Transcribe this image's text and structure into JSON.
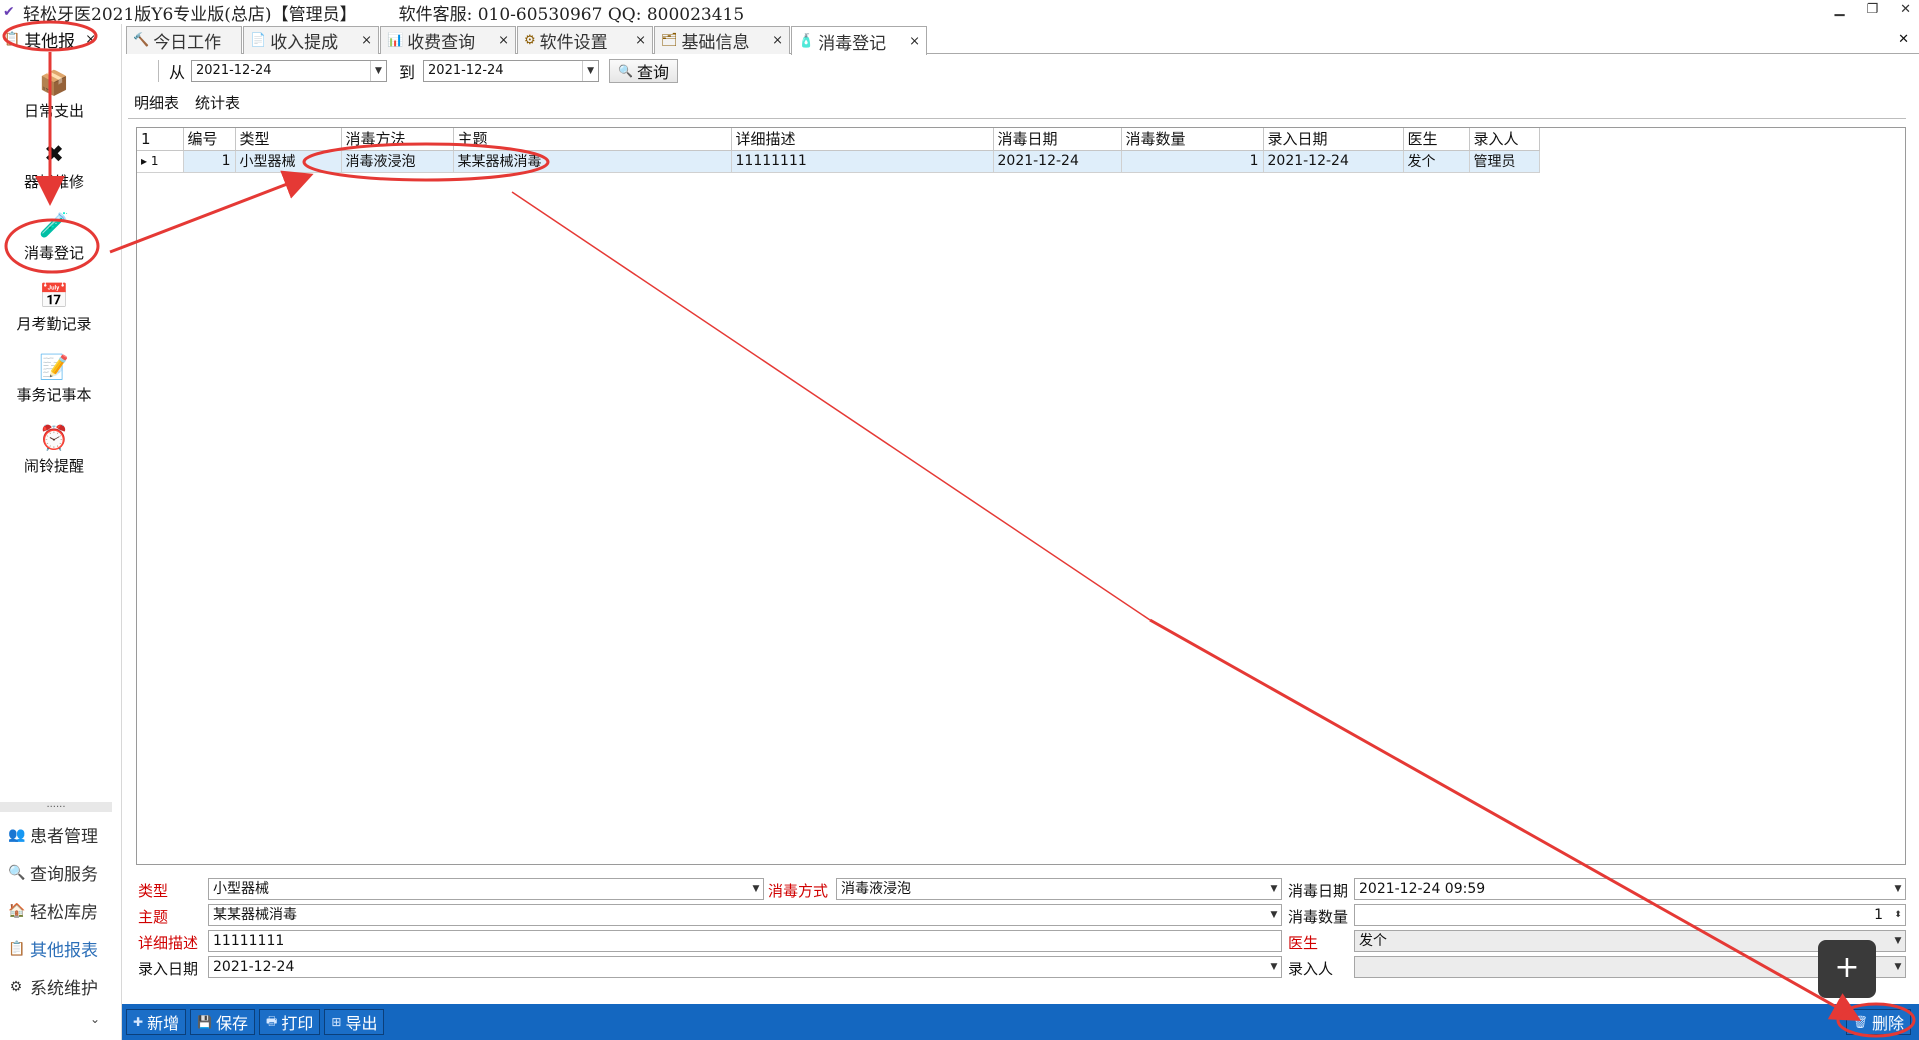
{
  "window": {
    "title": "轻松牙医2021版Y6专业版(总店)【管理员】",
    "service": "软件客服: 010-60530967  QQ: 800023415",
    "min_label": "▁",
    "restore_label": "❐",
    "close_label": "✕"
  },
  "sidebar": {
    "tab_label": "其他报",
    "tab_close": "×",
    "items": [
      {
        "label": "日常支出",
        "icon": "box-icon",
        "glyph": "📦"
      },
      {
        "label": "器械维修",
        "icon": "wrench-icon",
        "glyph": "✖"
      },
      {
        "label": "消毒登记",
        "icon": "disinfect-icon",
        "glyph": "🧪"
      },
      {
        "label": "月考勤记录",
        "icon": "calendar-icon",
        "glyph": "📅"
      },
      {
        "label": "事务记事本",
        "icon": "notepad-icon",
        "glyph": "📝"
      },
      {
        "label": "闹铃提醒",
        "icon": "alarm-clock-icon",
        "glyph": "⏰"
      }
    ],
    "sep_label": "......",
    "nav": [
      {
        "label": "患者管理",
        "icon": "patients-icon",
        "glyph": "👥"
      },
      {
        "label": "查询服务",
        "icon": "query-icon",
        "glyph": "🔍"
      },
      {
        "label": "轻松库房",
        "icon": "warehouse-icon",
        "glyph": "🏠"
      },
      {
        "label": "其他报表",
        "icon": "report-icon",
        "glyph": "📋"
      },
      {
        "label": "系统维护",
        "icon": "settings-icon",
        "glyph": "⚙"
      }
    ],
    "more_label": "⌄"
  },
  "tabs": [
    {
      "label": "今日工作",
      "icon": "work-icon",
      "glyph": "🔨"
    },
    {
      "label": "收入提成",
      "icon": "income-icon",
      "glyph": "📄"
    },
    {
      "label": "收费查询",
      "icon": "fee-query-icon",
      "glyph": "📊"
    },
    {
      "label": "软件设置",
      "icon": "software-settings-icon",
      "glyph": "⚙"
    },
    {
      "label": "基础信息",
      "icon": "basic-info-icon",
      "glyph": "🗂"
    },
    {
      "label": "消毒登记",
      "icon": "disinfect-tab-icon",
      "glyph": "🧴"
    }
  ],
  "tab_close": "×",
  "filter": {
    "from_label": "从",
    "from_value": "2021-12-24",
    "to_label": "到",
    "to_value": "2021-12-24",
    "query_label": "查询"
  },
  "subtabs": [
    "明细表",
    "统计表"
  ],
  "grid": {
    "corner": "1",
    "columns": [
      "编号",
      "类型",
      "消毒方法",
      "主题",
      "详细描述",
      "消毒日期",
      "消毒数量",
      "录入日期",
      "医生",
      "录入人"
    ],
    "rows": [
      {
        "marker": "▸ 1",
        "cells": [
          "1",
          "小型器械",
          "消毒液浸泡",
          "某某器械消毒",
          "11111111",
          "2021-12-24",
          "1",
          "2021-12-24",
          "发个",
          "管理员"
        ]
      }
    ]
  },
  "form": {
    "type_label": "类型",
    "type_value": "小型器械",
    "method_label": "消毒方式",
    "method_value": "消毒液浸泡",
    "date_label": "消毒日期",
    "date_value": "2021-12-24 09:59",
    "subject_label": "主题",
    "subject_value": "某某器械消毒",
    "qty_label": "消毒数量",
    "qty_value": "1",
    "desc_label": "详细描述",
    "desc_value": "11111111",
    "doctor_label": "医生",
    "doctor_value": "发个",
    "entry_date_label": "录入日期",
    "entry_date_value": "2021-12-24",
    "entered_by_label": "录入人",
    "entered_by_value": ""
  },
  "toolbar": {
    "new_label": "新增",
    "save_label": "保存",
    "print_label": "打印",
    "export_label": "导出",
    "delete_label": "删除"
  },
  "fab_label": "+",
  "colors": {
    "accent": "#1467c0",
    "required": "#d00000",
    "annotation": "#e53935",
    "selected_row": "#dfeefa"
  }
}
